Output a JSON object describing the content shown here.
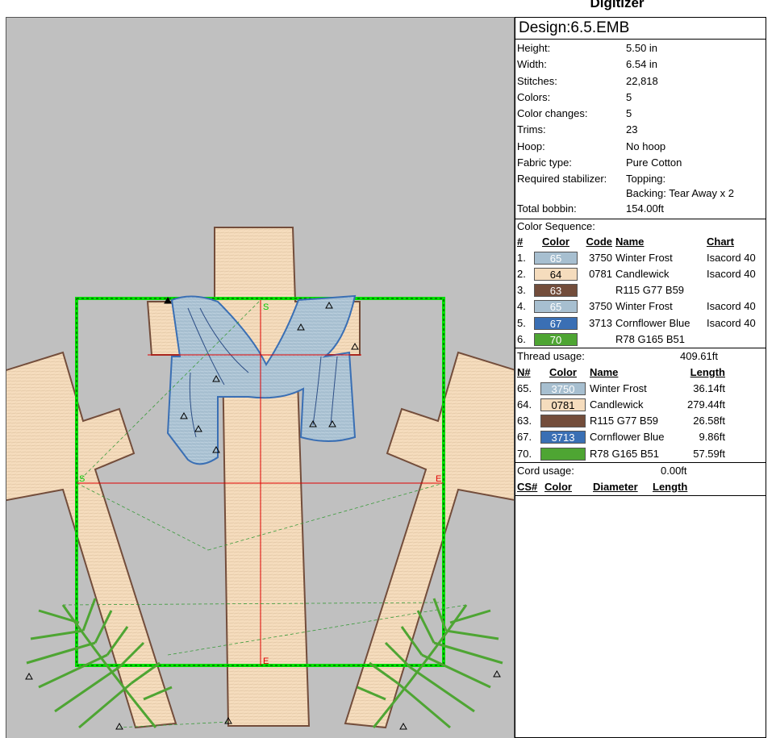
{
  "app": {
    "title": "Digitizer"
  },
  "design": {
    "title": "Design:6.5.EMB",
    "info": [
      {
        "label": "Height:",
        "value": "5.50 in"
      },
      {
        "label": "Width:",
        "value": "6.54 in"
      },
      {
        "label": "Stitches:",
        "value": "22,818"
      },
      {
        "label": "Colors:",
        "value": "5"
      },
      {
        "label": "Color changes:",
        "value": "5"
      },
      {
        "label": "Trims:",
        "value": "23"
      },
      {
        "label": "Hoop:",
        "value": "No hoop"
      },
      {
        "label": "Fabric type:",
        "value": "Pure Cotton"
      },
      {
        "label": "Required stabilizer:",
        "value": "Topping:",
        "value2": "Backing: Tear Away x 2"
      },
      {
        "label": "Total bobbin:",
        "value": "154.00ft"
      }
    ]
  },
  "color_sequence": {
    "title": "Color Sequence:",
    "headers": {
      "num": "#",
      "color": "Color",
      "code": "Code",
      "name": "Name",
      "chart": "Chart"
    },
    "rows": [
      {
        "num": "1.",
        "swatch": "65",
        "color": "#a7bfd0",
        "code": "3750",
        "name": "Winter Frost",
        "chart": "Isacord 40"
      },
      {
        "num": "2.",
        "swatch": "64",
        "color": "#f5dcbd",
        "code": "0781",
        "name": "Candlewick",
        "chart": "Isacord 40"
      },
      {
        "num": "3.",
        "swatch": "63",
        "color": "#734d3b",
        "code": "",
        "name": "R115 G77 B59",
        "chart": ""
      },
      {
        "num": "4.",
        "swatch": "65",
        "color": "#a7bfd0",
        "code": "3750",
        "name": "Winter Frost",
        "chart": "Isacord 40"
      },
      {
        "num": "5.",
        "swatch": "67",
        "color": "#3a6fb4",
        "code": "3713",
        "name": "Cornflower Blue",
        "chart": "Isacord 40"
      },
      {
        "num": "6.",
        "swatch": "70",
        "color": "#4ea533",
        "code": "",
        "name": "R78 G165 B51",
        "chart": ""
      }
    ]
  },
  "thread_usage": {
    "title": "Thread usage:",
    "total": "409.61ft",
    "headers": {
      "num": "N#",
      "color": "Color",
      "name": "Name",
      "length": "Length"
    },
    "rows": [
      {
        "num": "65.",
        "swatch": "3750",
        "color": "#a7bfd0",
        "name": "Winter Frost",
        "length": "36.14ft"
      },
      {
        "num": "64.",
        "swatch": "0781",
        "color": "#f5dcbd",
        "name": "Candlewick",
        "length": "279.44ft"
      },
      {
        "num": "63.",
        "swatch": "",
        "color": "#734d3b",
        "name": "R115 G77 B59",
        "length": "26.58ft"
      },
      {
        "num": "67.",
        "swatch": "3713",
        "color": "#3a6fb4",
        "name": "Cornflower Blue",
        "length": "9.86ft"
      },
      {
        "num": "70.",
        "swatch": "",
        "color": "#4ea533",
        "name": "R78 G165 B51",
        "length": "57.59ft"
      }
    ]
  },
  "cord_usage": {
    "title": "Cord usage:",
    "total": "0.00ft",
    "headers": {
      "num": "CS#",
      "color": "Color",
      "diameter": "Diameter",
      "length": "Length"
    }
  },
  "canvas_markers": {
    "start": "S",
    "end": "E"
  }
}
